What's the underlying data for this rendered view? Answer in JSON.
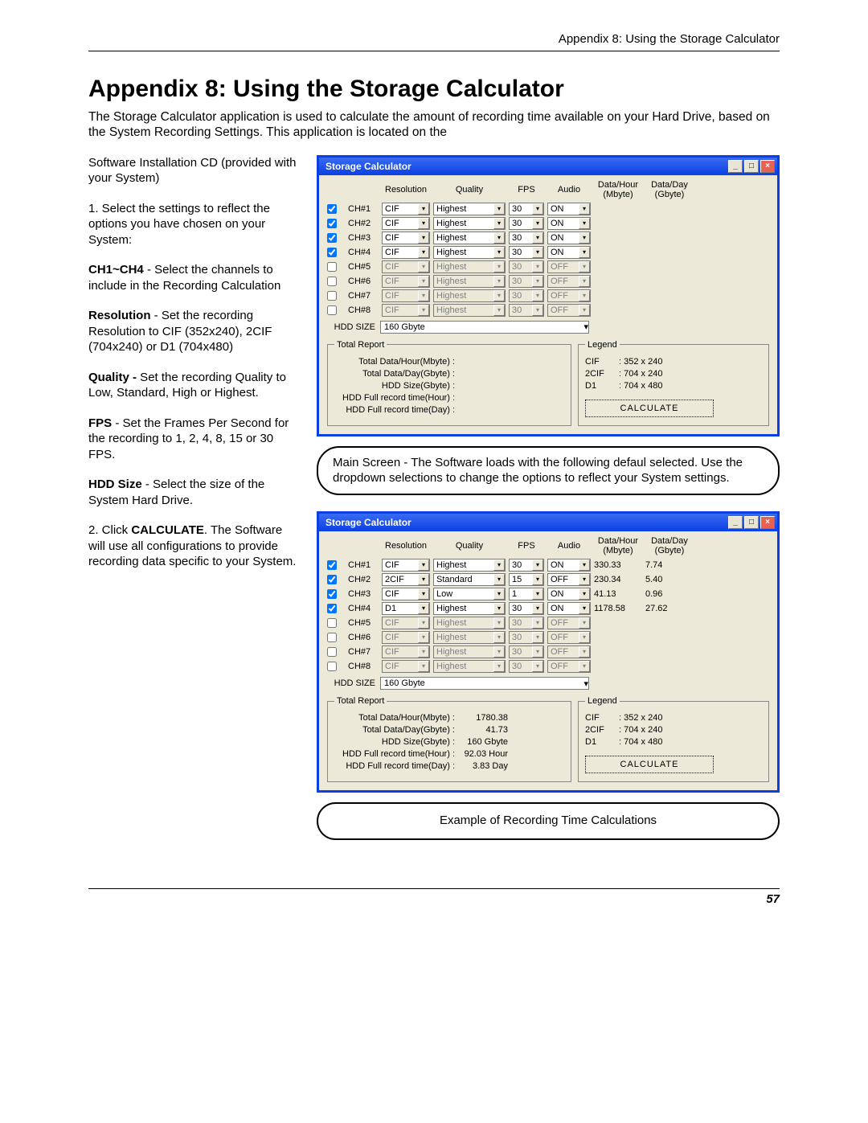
{
  "header": {
    "breadcrumb": "Appendix 8: Using the Storage Calculator"
  },
  "title": "Appendix 8: Using the Storage Calculator",
  "intro": "The Storage Calculator application is used to calculate the amount of recording time available on your Hard Drive, based on the System Recording Settings. This application is located on the",
  "left": {
    "p1": "Software Installation CD (provided with your System)",
    "p2": "1. Select the settings to reflect the options you have chosen on your System:",
    "p3a": "CH1~CH4",
    "p3b": " - Select the channels to include in the Recording Calculation",
    "p4a": "Resolution",
    "p4b": " - Set the recording Resolution to CIF (352x240), 2CIF (704x240) or D1 (704x480)",
    "p5a": "Quality -",
    "p5b": " Set the recording Quality to Low, Standard, High or Highest.",
    "p6a": "FPS",
    "p6b": " - Set the Frames Per Second for the recording to 1, 2, 4, 8, 15 or 30 FPS.",
    "p7a": "HDD Size",
    "p7b": " - Select the size of the System Hard Drive.",
    "p8a": "2. Click ",
    "p8b": "CALCULATE",
    "p8c": ". The Software will use all configurations to provide recording data specific to your System."
  },
  "win1": {
    "title": "Storage Calculator",
    "headers": {
      "res": "Resolution",
      "qual": "Quality",
      "fps": "FPS",
      "audio": "Audio",
      "dph": "Data/Hour (Mbyte)",
      "dpd": "Data/Day (Gbyte)"
    },
    "rows": [
      {
        "ch": "CH#1",
        "on": true,
        "res": "CIF",
        "qual": "Highest",
        "fps": "30",
        "audio": "ON",
        "dph": "",
        "dpd": ""
      },
      {
        "ch": "CH#2",
        "on": true,
        "res": "CIF",
        "qual": "Highest",
        "fps": "30",
        "audio": "ON",
        "dph": "",
        "dpd": ""
      },
      {
        "ch": "CH#3",
        "on": true,
        "res": "CIF",
        "qual": "Highest",
        "fps": "30",
        "audio": "ON",
        "dph": "",
        "dpd": ""
      },
      {
        "ch": "CH#4",
        "on": true,
        "res": "CIF",
        "qual": "Highest",
        "fps": "30",
        "audio": "ON",
        "dph": "",
        "dpd": ""
      },
      {
        "ch": "CH#5",
        "on": false,
        "res": "CIF",
        "qual": "Highest",
        "fps": "30",
        "audio": "OFF",
        "dph": "",
        "dpd": ""
      },
      {
        "ch": "CH#6",
        "on": false,
        "res": "CIF",
        "qual": "Highest",
        "fps": "30",
        "audio": "OFF",
        "dph": "",
        "dpd": ""
      },
      {
        "ch": "CH#7",
        "on": false,
        "res": "CIF",
        "qual": "Highest",
        "fps": "30",
        "audio": "OFF",
        "dph": "",
        "dpd": ""
      },
      {
        "ch": "CH#8",
        "on": false,
        "res": "CIF",
        "qual": "Highest",
        "fps": "30",
        "audio": "OFF",
        "dph": "",
        "dpd": ""
      }
    ],
    "hdd_label": "HDD SIZE",
    "hdd_value": "160 Gbyte",
    "report": {
      "title": "Total Report",
      "l1": "Total Data/Hour(Mbyte) :",
      "v1": "",
      "l2": "Total Data/Day(Gbyte) :",
      "v2": "",
      "l3": "HDD Size(Gbyte) :",
      "v3": "",
      "l4": "HDD Full record time(Hour) :",
      "v4": "",
      "l5": "HDD Full record time(Day) :",
      "v5": ""
    },
    "legend": {
      "title": "Legend",
      "cif": "CIF",
      "cifv": ": 352 x 240",
      "tcif": "2CIF",
      "tcifv": ": 704 x 240",
      "d1": "D1",
      "d1v": ": 704 x 480",
      "btn": "CALCULATE"
    }
  },
  "callout1": "Main Screen - The Software loads with the following defaul selected. Use the dropdown selections to change the options to reflect your System settings.",
  "win2": {
    "title": "Storage Calculator",
    "rows": [
      {
        "ch": "CH#1",
        "on": true,
        "res": "CIF",
        "qual": "Highest",
        "fps": "30",
        "audio": "ON",
        "dph": "330.33",
        "dpd": "7.74"
      },
      {
        "ch": "CH#2",
        "on": true,
        "res": "2CIF",
        "qual": "Standard",
        "fps": "15",
        "audio": "OFF",
        "dph": "230.34",
        "dpd": "5.40"
      },
      {
        "ch": "CH#3",
        "on": true,
        "res": "CIF",
        "qual": "Low",
        "fps": "1",
        "audio": "ON",
        "dph": "41.13",
        "dpd": "0.96"
      },
      {
        "ch": "CH#4",
        "on": true,
        "res": "D1",
        "qual": "Highest",
        "fps": "30",
        "audio": "ON",
        "dph": "1178.58",
        "dpd": "27.62"
      },
      {
        "ch": "CH#5",
        "on": false,
        "res": "CIF",
        "qual": "Highest",
        "fps": "30",
        "audio": "OFF",
        "dph": "",
        "dpd": ""
      },
      {
        "ch": "CH#6",
        "on": false,
        "res": "CIF",
        "qual": "Highest",
        "fps": "30",
        "audio": "OFF",
        "dph": "",
        "dpd": ""
      },
      {
        "ch": "CH#7",
        "on": false,
        "res": "CIF",
        "qual": "Highest",
        "fps": "30",
        "audio": "OFF",
        "dph": "",
        "dpd": ""
      },
      {
        "ch": "CH#8",
        "on": false,
        "res": "CIF",
        "qual": "Highest",
        "fps": "30",
        "audio": "OFF",
        "dph": "",
        "dpd": ""
      }
    ],
    "hdd_value": "160 Gbyte",
    "report": {
      "v1": "1780.38",
      "v2": "41.73",
      "v3": "160 Gbyte",
      "v4": "92.03 Hour",
      "v5": "3.83 Day"
    }
  },
  "callout2": "Example of Recording Time Calculations",
  "page_number": "57"
}
